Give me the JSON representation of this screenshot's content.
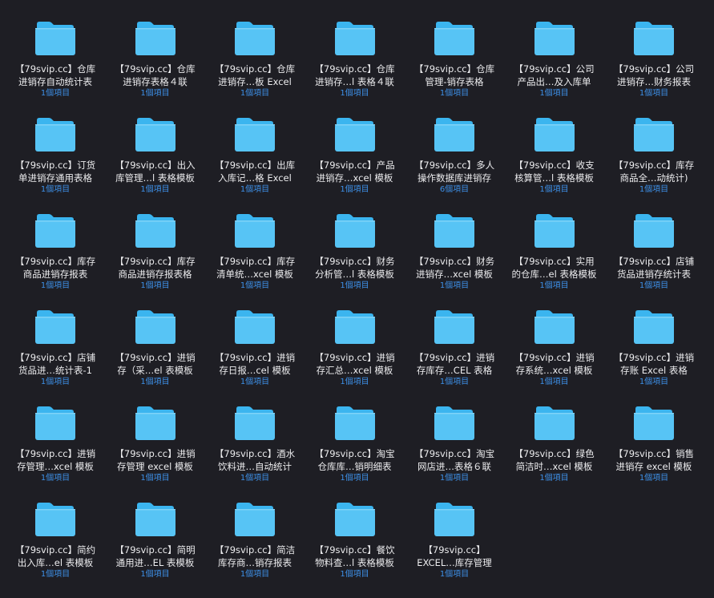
{
  "folder_icon": "folder-icon",
  "colors": {
    "background": "#1e1e24",
    "folder_back": "#3bb5ef",
    "folder_front": "#57c4f5",
    "count_text": "#3d8fe6"
  },
  "items": [
    {
      "line1": "【79svip.cc】仓库",
      "line2": "进销存自动统计表",
      "count": "1個項目"
    },
    {
      "line1": "【79svip.cc】仓库",
      "line2": "进销存表格４联",
      "count": "1個項目"
    },
    {
      "line1": "【79svip.cc】仓库",
      "line2": "进销存…板 Excel",
      "count": "1個項目"
    },
    {
      "line1": "【79svip.cc】仓库",
      "line2": "进销存…l 表格４联",
      "count": "1個項目"
    },
    {
      "line1": "【79svip.cc】仓库",
      "line2": "管理-销存表格",
      "count": "1個項目"
    },
    {
      "line1": "【79svip.cc】公司",
      "line2": "产品出…及入库单",
      "count": "1個項目"
    },
    {
      "line1": "【79svip.cc】公司",
      "line2": "进销存…财务报表",
      "count": "1個項目"
    },
    {
      "line1": "【79svip.cc】订货",
      "line2": "单进销存通用表格",
      "count": "1個項目"
    },
    {
      "line1": "【79svip.cc】出入",
      "line2": "库管理…l 表格模板",
      "count": "1個項目"
    },
    {
      "line1": "【79svip.cc】出库",
      "line2": "入库记…格 Excel",
      "count": "1個項目"
    },
    {
      "line1": "【79svip.cc】产品",
      "line2": "进销存…xcel 模板",
      "count": "1個項目"
    },
    {
      "line1": "【79svip.cc】多人",
      "line2": "操作数据库进销存",
      "count": "6個項目"
    },
    {
      "line1": "【79svip.cc】收支",
      "line2": "核算管…l 表格模板",
      "count": "1個項目"
    },
    {
      "line1": "【79svip.cc】库存",
      "line2": "商品全…动统计)",
      "count": "1個項目"
    },
    {
      "line1": "【79svip.cc】库存",
      "line2": "商品进销存报表",
      "count": "1個項目"
    },
    {
      "line1": "【79svip.cc】库存",
      "line2": "商品进销存报表格",
      "count": "1個項目"
    },
    {
      "line1": "【79svip.cc】库存",
      "line2": "清单统…xcel 模板",
      "count": "1個項目"
    },
    {
      "line1": "【79svip.cc】财务",
      "line2": "分析管…l 表格模板",
      "count": "1個項目"
    },
    {
      "line1": "【79svip.cc】财务",
      "line2": "进销存…xcel 模板",
      "count": "1個項目"
    },
    {
      "line1": "【79svip.cc】实用",
      "line2": "的仓库…el 表格模板",
      "count": "1個項目"
    },
    {
      "line1": "【79svip.cc】店铺",
      "line2": "货品进销存统计表",
      "count": "1個項目"
    },
    {
      "line1": "【79svip.cc】店铺",
      "line2": "货品进…统计表-1",
      "count": "1個項目"
    },
    {
      "line1": "【79svip.cc】进销",
      "line2": "存（采…el 表模板",
      "count": "1個項目"
    },
    {
      "line1": "【79svip.cc】进销",
      "line2": "存日报…cel 模板",
      "count": "1個項目"
    },
    {
      "line1": "【79svip.cc】进销",
      "line2": "存汇总…xcel 模板",
      "count": "1個項目"
    },
    {
      "line1": "【79svip.cc】进销",
      "line2": "存库存…CEL 表格",
      "count": "1個項目"
    },
    {
      "line1": "【79svip.cc】进销",
      "line2": "存系统…xcel 模板",
      "count": "1個項目"
    },
    {
      "line1": "【79svip.cc】进销",
      "line2": "存账 Excel 表格",
      "count": "1個項目"
    },
    {
      "line1": "【79svip.cc】进销",
      "line2": "存管理…xcel 模板",
      "count": "1個項目"
    },
    {
      "line1": "【79svip.cc】进销",
      "line2": "存管理 excel 模板",
      "count": "1個項目"
    },
    {
      "line1": "【79svip.cc】酒水",
      "line2": "饮料进…自动统计",
      "count": "1個項目"
    },
    {
      "line1": "【79svip.cc】淘宝",
      "line2": "仓库库…销明细表",
      "count": "1個項目"
    },
    {
      "line1": "【79svip.cc】淘宝",
      "line2": "网店进…表格６联",
      "count": "1個項目"
    },
    {
      "line1": "【79svip.cc】绿色",
      "line2": "简洁时…xcel 模板",
      "count": "1個項目"
    },
    {
      "line1": "【79svip.cc】销售",
      "line2": "进销存 excel 模板",
      "count": "1個項目"
    },
    {
      "line1": "【79svip.cc】简约",
      "line2": "出入库…el 表模板",
      "count": "1個項目"
    },
    {
      "line1": "【79svip.cc】简明",
      "line2": "通用进…EL 表模板",
      "count": "1個項目"
    },
    {
      "line1": "【79svip.cc】简洁",
      "line2": "库存商…销存报表",
      "count": "1個項目"
    },
    {
      "line1": "【79svip.cc】餐饮",
      "line2": "物料查…l 表格模板",
      "count": "1個項目"
    },
    {
      "line1": "【79svip.cc】",
      "line2": "EXCEL…库存管理",
      "count": "1個項目"
    }
  ]
}
